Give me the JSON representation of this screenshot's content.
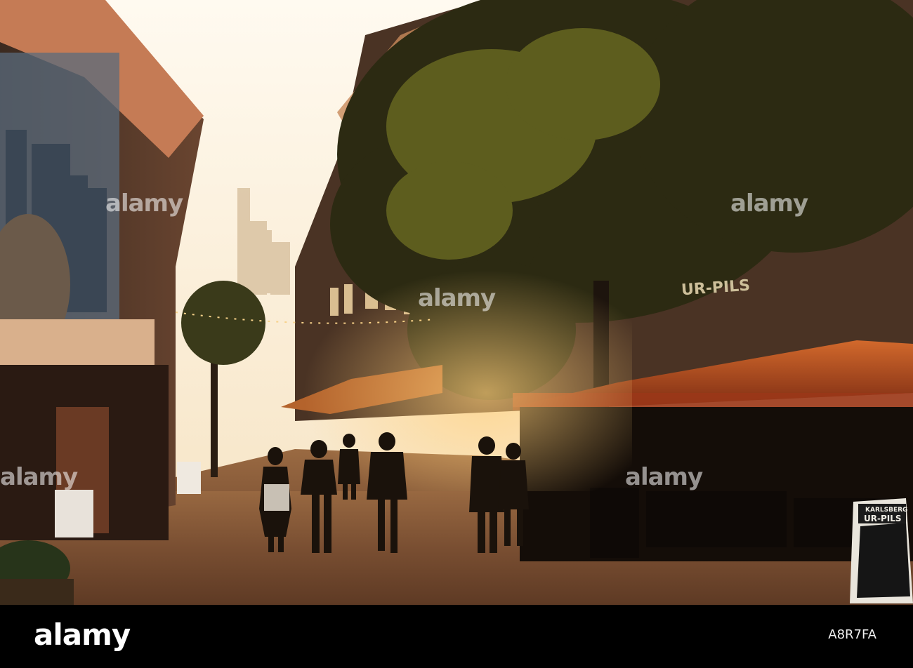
{
  "image": {
    "scene": "Pedestrian cobblestone street with outdoor cafes at sunset, skyscrapers in the distance",
    "colors": {
      "sky": "#fff6e3",
      "warm_glow": "#d9a15b",
      "shadow": "#1a120a",
      "awning": "#b24a1f",
      "cobble": "#8a5a3a"
    }
  },
  "signs": {
    "bar_sign": "UR-PILS",
    "sandwich_board_top": "KARLSBERG",
    "sandwich_board_main": "UR-PILS"
  },
  "watermark": {
    "text": "alamy"
  },
  "footer": {
    "brand": "alamy",
    "reference": "A8R7FA"
  }
}
